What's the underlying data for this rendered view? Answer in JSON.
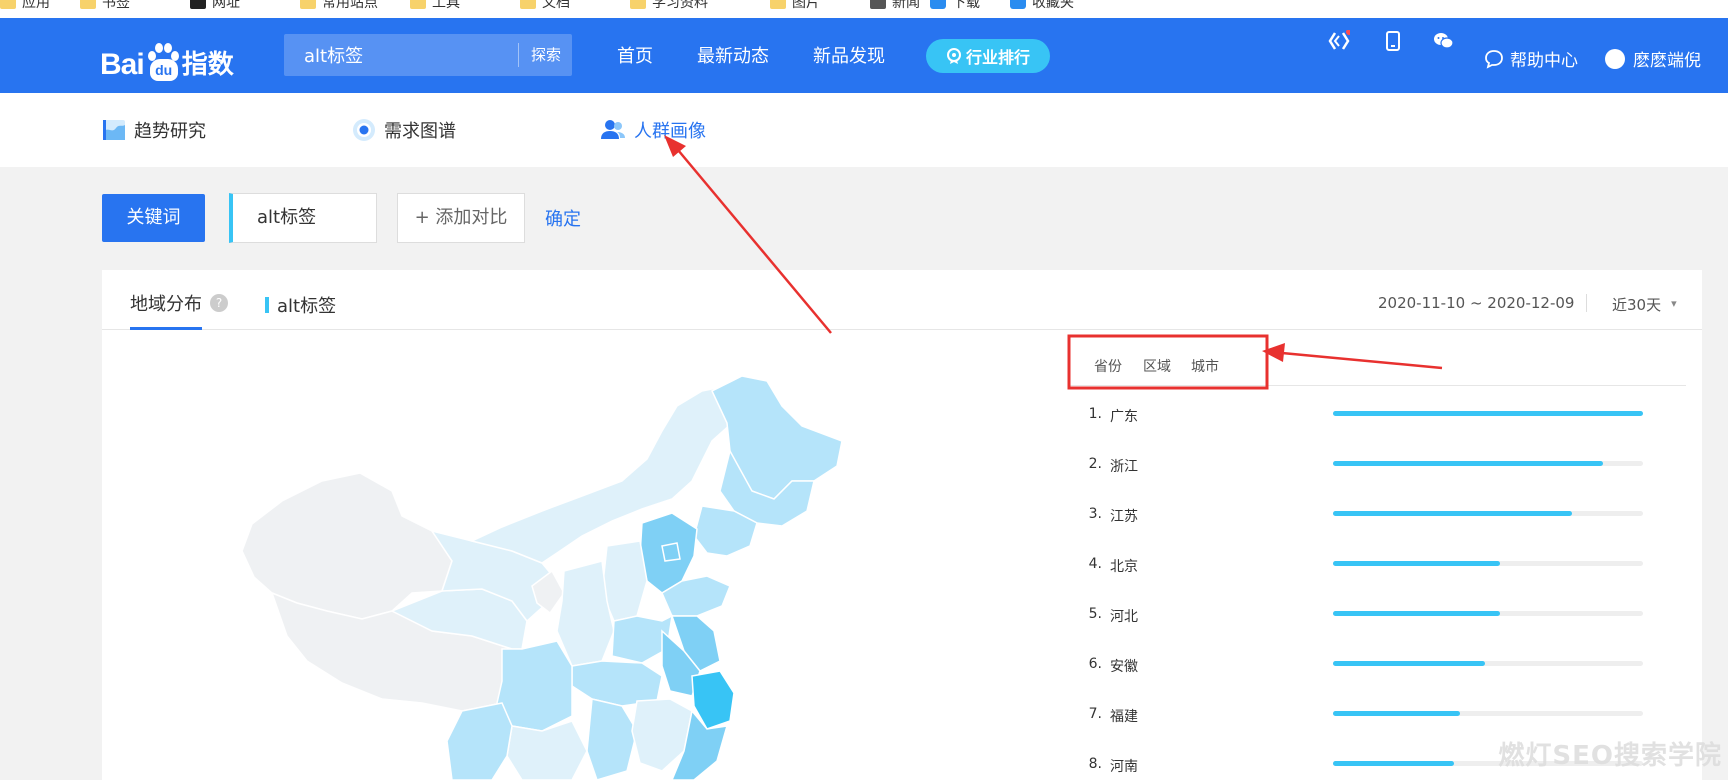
{
  "bookmarks": [
    "应用",
    "书签",
    "网址",
    "常用站点",
    "工具",
    "文档",
    "学习资料",
    "图片",
    "新闻",
    "下载",
    "收藏夹"
  ],
  "topbar": {
    "logo_text": "Bai",
    "logo_paw_text": "du",
    "logo_suffix": "指数",
    "search_value": "alt标签",
    "search_button": "探索",
    "nav": [
      "首页",
      "最新动态",
      "新品发现"
    ],
    "rank_button": "行业排行",
    "help_label": "帮助中心",
    "user_name": "麽麽端倪"
  },
  "subnav": {
    "trend": "趋势研究",
    "demand": "需求图谱",
    "crowd": "人群画像"
  },
  "keyword_row": {
    "keyword_button": "关键词",
    "keyword_value": "alt标签",
    "add_compare": "+ 添加对比",
    "confirm": "确定"
  },
  "panel": {
    "tab_region": "地域分布",
    "help_mark": "?",
    "series_name": "alt标签",
    "date_range": "2020-11-10 ~ 2020-12-09",
    "period": "近30天",
    "period_caret": "▾"
  },
  "region_tabs": [
    "省份",
    "区域",
    "城市"
  ],
  "ranking": [
    {
      "rank": "1.",
      "name": "广东",
      "value": 1.0
    },
    {
      "rank": "2.",
      "name": "浙江",
      "value": 0.87
    },
    {
      "rank": "3.",
      "name": "江苏",
      "value": 0.77
    },
    {
      "rank": "4.",
      "name": "北京",
      "value": 0.54
    },
    {
      "rank": "5.",
      "name": "河北",
      "value": 0.54
    },
    {
      "rank": "6.",
      "name": "安徽",
      "value": 0.49
    },
    {
      "rank": "7.",
      "name": "福建",
      "value": 0.41
    },
    {
      "rank": "8.",
      "name": "河南",
      "value": 0.39
    }
  ],
  "colors": {
    "brand_blue": "#2874f0",
    "accent_cyan": "#38c4f5",
    "annotation_red": "#e8312f"
  },
  "watermark": "燃灯SEO搜索学院"
}
